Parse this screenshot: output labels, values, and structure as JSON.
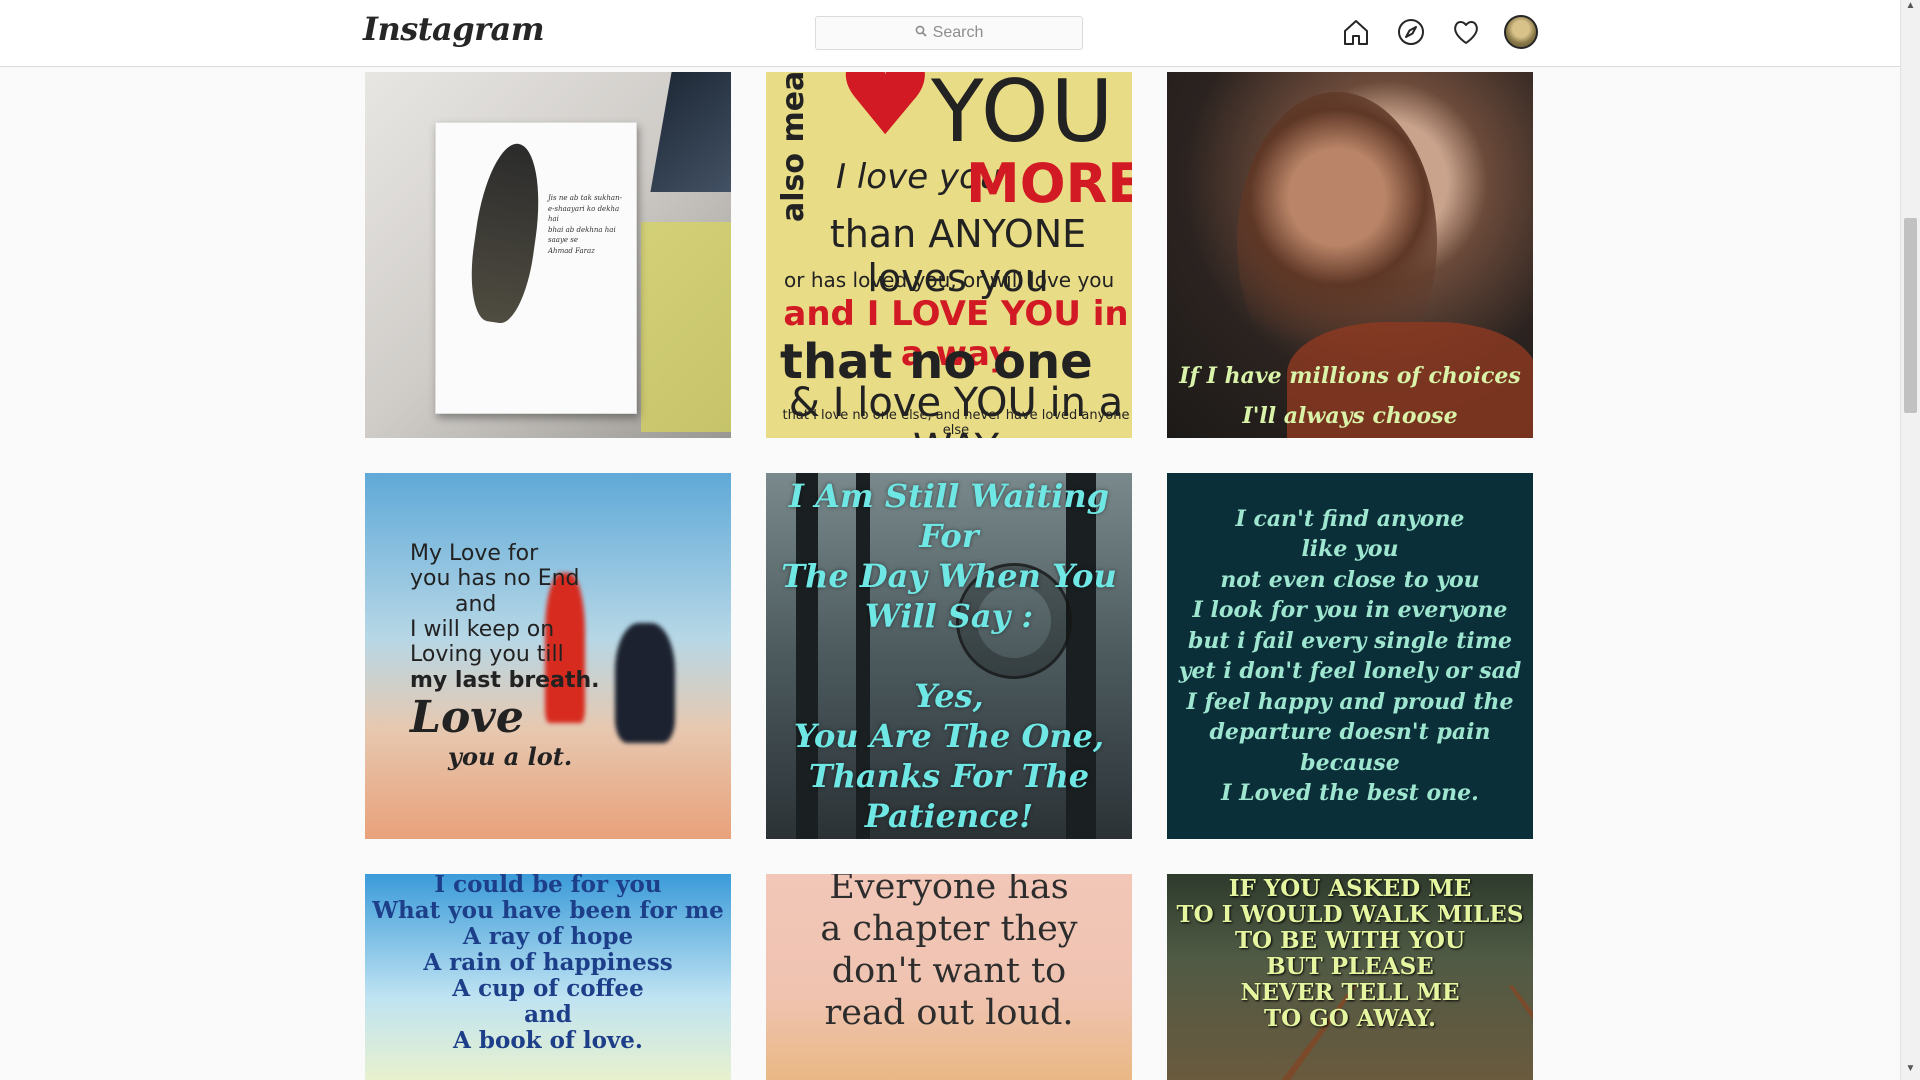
{
  "header": {
    "logo": "Instagram",
    "search": {
      "placeholder": "Search",
      "icon": "search-icon"
    },
    "nav": [
      {
        "name": "home-icon"
      },
      {
        "name": "explore-icon"
      },
      {
        "name": "activity-heart-icon"
      },
      {
        "name": "profile-avatar"
      }
    ]
  },
  "tiles": {
    "t1": {
      "verse": [
        "Jis ne ab tak sukhan-e-shaayari ko dekha hai",
        "bhai ab dekhna hai saaye se",
        "Ahmad Faraz"
      ]
    },
    "t2": {
      "l1": "YOU",
      "also": "also means",
      "l2": "I love you",
      "l3": "MORE",
      "l4": "than ANYONE loves you",
      "l5": "or has loved you, or will love you",
      "l6": "and I LOVE YOU in a way",
      "l7": "that no one",
      "l8": "& I love YOU in a WAY",
      "l9": "that I love no one else, and never have loved anyone else"
    },
    "t3": {
      "line1": "If I have millions of choices",
      "line2": "I'll always choose"
    },
    "t4": {
      "line1": "My Love for",
      "line2": "you has no End",
      "line3": "and",
      "line4": "I will keep on",
      "line5": "Loving you till",
      "line6": "my last breath.",
      "line7": "Love",
      "line8": "you a lot."
    },
    "t5": {
      "line1": "I Am Still Waiting For",
      "line2": "The Day When You",
      "line3": "Will Say :",
      "line4": "Yes,",
      "line5": "You Are The One,",
      "line6": "Thanks For The",
      "line7": "Patience!"
    },
    "t6": [
      "I can't find anyone",
      "like you",
      "not even close to you",
      "I look for you in everyone",
      "but i fail every single time",
      "yet i don't feel lonely or sad",
      "I feel happy and proud the",
      "departure doesn't pain",
      "because",
      "I Loved the best one."
    ],
    "t7": [
      "I could be for you",
      "What you have been for me",
      "A ray of hope",
      "A rain of happiness",
      "A cup of coffee",
      "and",
      "A book of love."
    ],
    "t8": [
      "Everyone has",
      "a chapter they",
      "don't want to",
      "read out loud."
    ],
    "t9": [
      "IF YOU ASKED ME",
      "TO I WOULD WALK MILES",
      "TO BE WITH YOU",
      "BUT PLEASE",
      "NEVER TELL ME",
      "TO GO AWAY."
    ]
  }
}
